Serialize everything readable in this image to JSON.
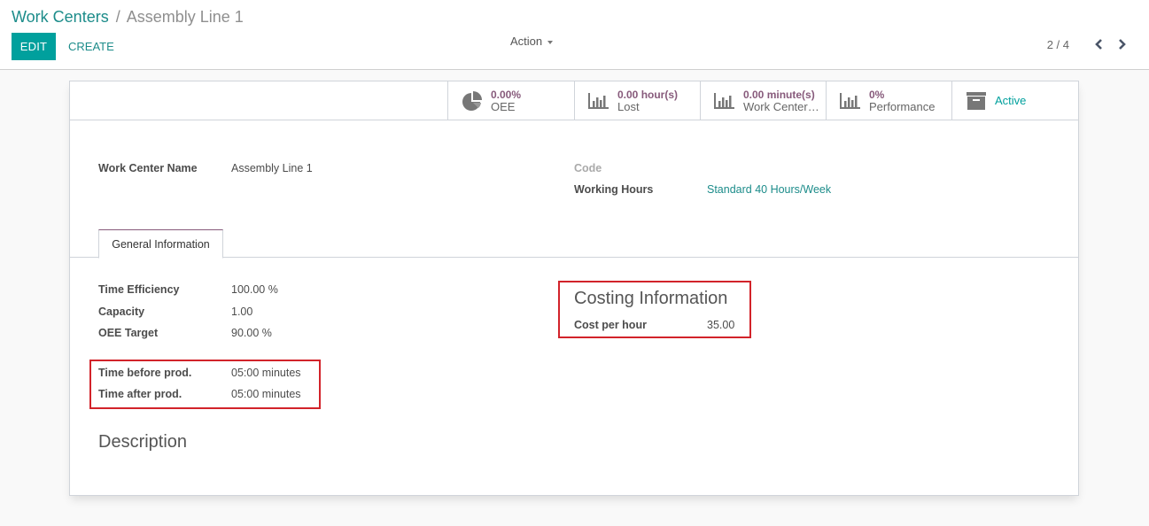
{
  "breadcrumb": {
    "parent": "Work Centers",
    "separator": "/",
    "current": "Assembly Line 1"
  },
  "toolbar": {
    "edit_label": "EDIT",
    "create_label": "CREATE",
    "action_label": "Action"
  },
  "pager": {
    "value": "2 / 4",
    "prev_icon": "chevron-left-icon",
    "next_icon": "chevron-right-icon"
  },
  "stat_buttons": [
    {
      "icon": "pie-chart-icon",
      "value": "0.00%",
      "label": "OEE"
    },
    {
      "icon": "bar-chart-icon",
      "value": "0.00 hour(s)",
      "label": "Lost"
    },
    {
      "icon": "bar-chart-icon",
      "value": "0.00 minute(s)",
      "label": "Work Center…"
    },
    {
      "icon": "bar-chart-icon",
      "value": "0%",
      "label": "Performance"
    },
    {
      "icon": "archive-icon",
      "label": "Active"
    }
  ],
  "header_fields": {
    "name_label": "Work Center Name",
    "name_value": "Assembly Line 1",
    "code_label": "Code",
    "code_value": "",
    "working_hours_label": "Working Hours",
    "working_hours_value": "Standard 40 Hours/Week"
  },
  "tabs": [
    {
      "label": "General Information",
      "active": true
    }
  ],
  "general": {
    "fields": [
      {
        "label": "Time Efficiency",
        "value": "100.00 %"
      },
      {
        "label": "Capacity",
        "value": "1.00"
      },
      {
        "label": "OEE Target",
        "value": "90.00 %"
      }
    ],
    "time_fields": [
      {
        "label": "Time before prod.",
        "value": "05:00 minutes"
      },
      {
        "label": "Time after prod.",
        "value": "05:00 minutes"
      }
    ],
    "costing_title": "Costing Information",
    "cost_label": "Cost per hour",
    "cost_value": "35.00",
    "description_title": "Description"
  },
  "colors": {
    "primary": "#00a09d",
    "stat_value": "#875a7b",
    "highlight": "#d2232a"
  }
}
